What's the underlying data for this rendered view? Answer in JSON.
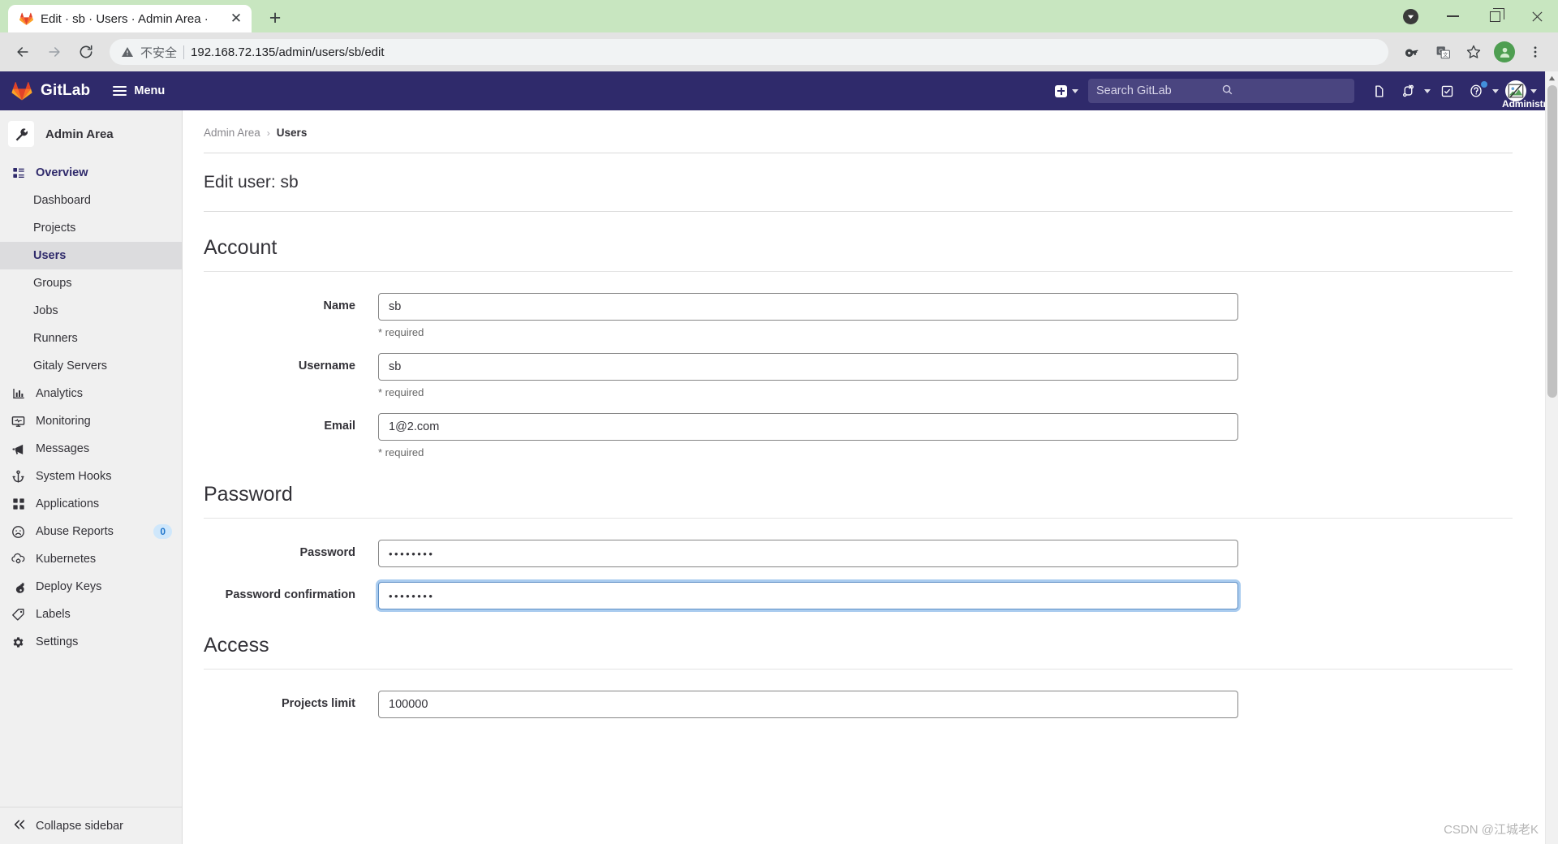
{
  "browser": {
    "tab": {
      "title": "Edit · sb · Users · Admin Area ·",
      "favicon": "gitlab-favicon",
      "close_label": "✕"
    },
    "new_tab_label": "+",
    "window_controls": {
      "download": "download-indicator",
      "minimize": "—",
      "maximize": "❐",
      "close": "✕"
    },
    "nav": {
      "back": "back-icon",
      "forward": "forward-icon",
      "reload": "reload-icon"
    },
    "omnibox": {
      "security_label": "不安全",
      "url": "192.168.72.135/admin/users/sb/edit"
    },
    "toolbar_right": {
      "password_manager": "key-icon",
      "translate": "translate-icon",
      "bookmark": "star-icon",
      "profile": "profile-avatar",
      "menu": "three-dot-menu"
    }
  },
  "gitlab_nav": {
    "brand": "GitLab",
    "menu_label": "Menu",
    "create_new": "plus-square-icon",
    "search_placeholder": "Search GitLab",
    "icons": [
      {
        "name": "issues-icon",
        "label": "Issues"
      },
      {
        "name": "merge-requests-icon",
        "label": "Merge requests"
      },
      {
        "name": "todos-icon",
        "label": "To-Do List"
      },
      {
        "name": "help-icon",
        "label": "Help"
      }
    ],
    "user": {
      "name": "Administrato",
      "avatar": "broken-image-avatar"
    }
  },
  "sidebar": {
    "header": {
      "title": "Admin Area",
      "icon": "wrench-icon"
    },
    "overview": {
      "label": "Overview",
      "icon": "overview-list-icon"
    },
    "overview_children": [
      {
        "label": "Dashboard",
        "active": false
      },
      {
        "label": "Projects",
        "active": false
      },
      {
        "label": "Users",
        "active": true
      },
      {
        "label": "Groups",
        "active": false
      },
      {
        "label": "Jobs",
        "active": false
      },
      {
        "label": "Runners",
        "active": false
      },
      {
        "label": "Gitaly Servers",
        "active": false
      }
    ],
    "items": [
      {
        "label": "Analytics",
        "icon": "chart-icon",
        "badge": null
      },
      {
        "label": "Monitoring",
        "icon": "monitor-icon",
        "badge": null
      },
      {
        "label": "Messages",
        "icon": "megaphone-icon",
        "badge": null
      },
      {
        "label": "System Hooks",
        "icon": "hook-icon",
        "badge": null
      },
      {
        "label": "Applications",
        "icon": "grid-icon",
        "badge": null
      },
      {
        "label": "Abuse Reports",
        "icon": "frown-face-icon",
        "badge": "0"
      },
      {
        "label": "Kubernetes",
        "icon": "kubernetes-icon",
        "badge": null
      },
      {
        "label": "Deploy Keys",
        "icon": "key-icon",
        "badge": null
      },
      {
        "label": "Labels",
        "icon": "label-tag-icon",
        "badge": null
      },
      {
        "label": "Settings",
        "icon": "gear-icon",
        "badge": null
      }
    ],
    "footer": {
      "label": "Collapse sidebar",
      "icon": "double-chevron-left-icon"
    }
  },
  "main": {
    "breadcrumb": {
      "root": "Admin Area",
      "separator": "›",
      "current": "Users"
    },
    "page_title": "Edit user: sb",
    "sections": [
      {
        "title": "Account",
        "fields": [
          {
            "label": "Name",
            "value": "sb",
            "hint": "* required",
            "type": "text",
            "focused": false
          },
          {
            "label": "Username",
            "value": "sb",
            "hint": "* required",
            "type": "text",
            "focused": false
          },
          {
            "label": "Email",
            "value": "1@2.com",
            "hint": "* required",
            "type": "text",
            "focused": false
          }
        ]
      },
      {
        "title": "Password",
        "fields": [
          {
            "label": "Password",
            "value": "••••••••",
            "hint": "",
            "type": "password",
            "focused": false
          },
          {
            "label": "Password confirmation",
            "value": "••••••••",
            "hint": "",
            "type": "password",
            "focused": true
          }
        ]
      },
      {
        "title": "Access",
        "fields": [
          {
            "label": "Projects limit",
            "value": "100000",
            "hint": "",
            "type": "number",
            "focused": false
          }
        ]
      }
    ]
  },
  "watermark": "CSDN @江城老K",
  "colors": {
    "gitlab_nav": "#2f2a6b",
    "accent": "#1f75cb",
    "tabstrip": "#c8e6c0",
    "sidebar_bg": "#f0f0f0",
    "active_item": "#dcdcde",
    "focus_ring": "#428fdc"
  }
}
